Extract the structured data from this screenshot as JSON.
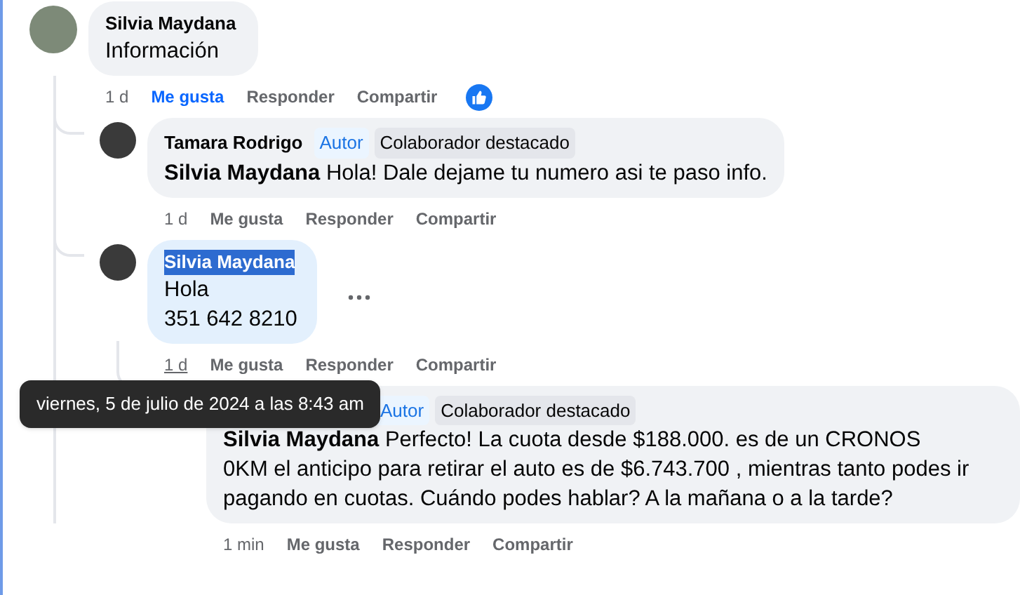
{
  "comments": [
    {
      "author": "Silvia Maydana",
      "name_selected": false,
      "lines": [
        "Información"
      ],
      "time": "1 d",
      "time_hovered": false,
      "actions": [
        {
          "label": "Me gusta",
          "selected": true
        },
        {
          "label": "Responder",
          "selected": false
        },
        {
          "label": "Compartir",
          "selected": false
        }
      ],
      "reaction_icon": true,
      "children": [
        {
          "author": "Tamara Rodrigo",
          "name_selected": false,
          "badges": [
            {
              "kind": "author",
              "text": "Autor"
            },
            {
              "kind": "top",
              "text": "Colaborador destacado"
            }
          ],
          "mention": "Silvia Maydana",
          "lines": [
            "Hola! Dale dejame tu numero asi te paso info."
          ],
          "time": "1 d",
          "time_hovered": false,
          "actions": [
            {
              "label": "Me gusta",
              "selected": false
            },
            {
              "label": "Responder",
              "selected": false
            },
            {
              "label": "Compartir",
              "selected": false
            }
          ]
        },
        {
          "author": "Silvia Maydana",
          "name_selected": true,
          "lines": [
            "Hola",
            "351 642 8210"
          ],
          "time": "1 d",
          "time_hovered": true,
          "actions": [
            {
              "label": "Me gusta",
              "selected": false
            },
            {
              "label": "Responder",
              "selected": false
            },
            {
              "label": "Compartir",
              "selected": false
            }
          ],
          "more_button": true,
          "children": [
            {
              "badges": [
                {
                  "kind": "author",
                  "text": "Autor"
                },
                {
                  "kind": "top",
                  "text": "Colaborador destacado"
                }
              ],
              "mention": "Silvia Maydana",
              "lines": [
                "Perfecto! La cuota desde $188.000. es de un CRONOS 0KM el anticipo para retirar el auto es de $6.743.700 , mientras tanto podes ir pagando en cuotas. Cuándo podes hablar? A la mañana o a la tarde?"
              ],
              "time": "1 min",
              "time_hovered": false,
              "actions": [
                {
                  "label": "Me gusta",
                  "selected": false
                },
                {
                  "label": "Responder",
                  "selected": false
                },
                {
                  "label": "Compartir",
                  "selected": false
                }
              ]
            }
          ]
        }
      ]
    }
  ],
  "tooltip": {
    "text": "viernes, 5 de julio de 2024 a las 8:43 am"
  }
}
